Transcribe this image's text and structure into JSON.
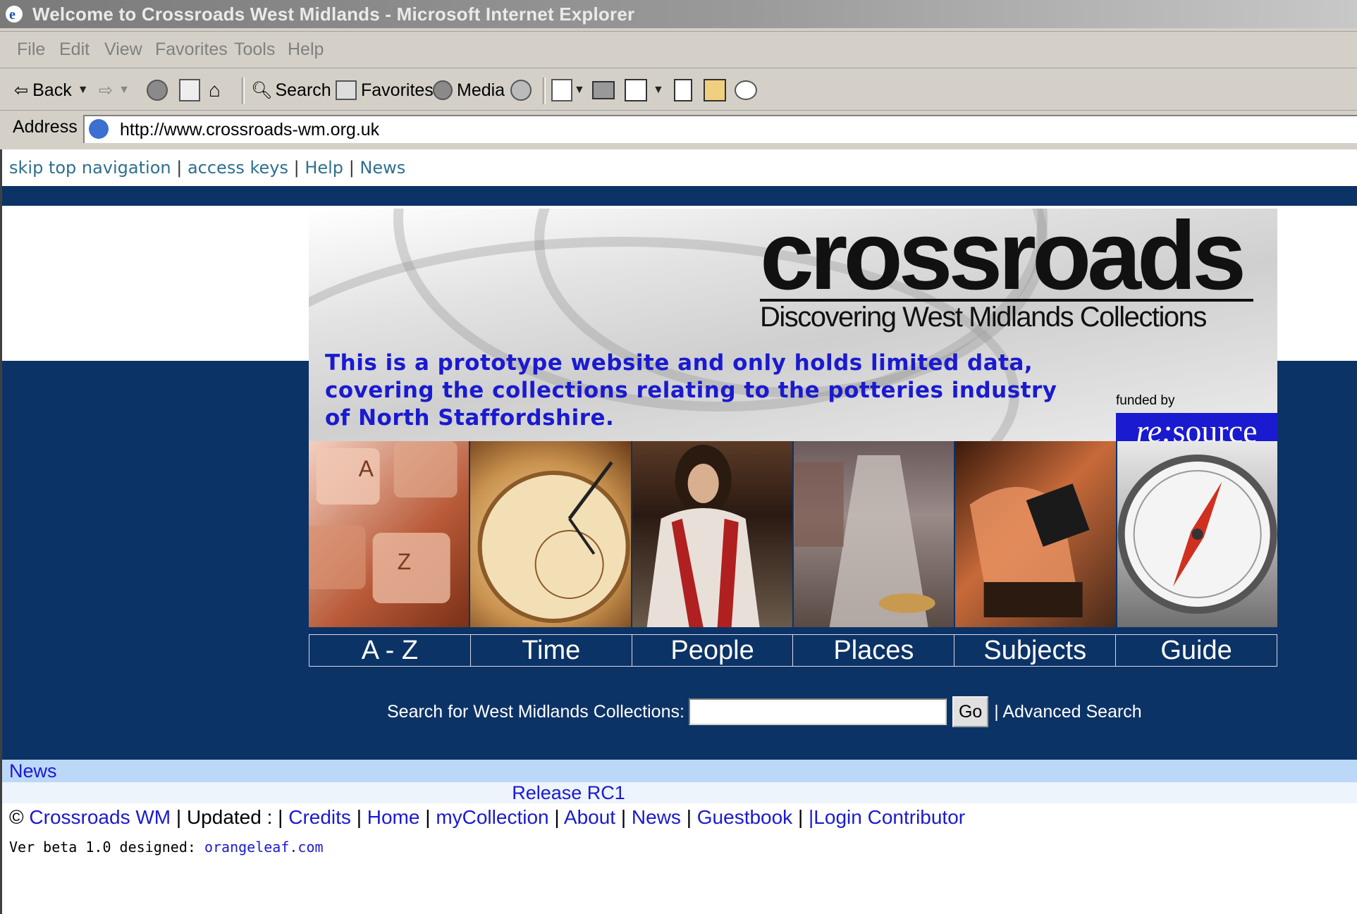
{
  "window": {
    "title": "Welcome to Crossroads West Midlands - Microsoft Internet Explorer"
  },
  "menu": [
    "File",
    "Edit",
    "View",
    "Favorites",
    "Tools",
    "Help"
  ],
  "toolbar": {
    "back": "Back",
    "search": "Search",
    "favorites": "Favorites",
    "media": "Media"
  },
  "address": {
    "label": "Address",
    "url": "http://www.crossroads-wm.org.uk"
  },
  "topnav": [
    "skip top navigation",
    "access keys",
    "Help",
    "News"
  ],
  "banner": {
    "brand": "crossroads",
    "subtitle": "Discovering West Midlands Collections",
    "notice": "This is a prototype website and only holds limited data, covering the collections relating to the potteries industry of North Staffordshire.",
    "funded_by": "funded by",
    "funder_prefix": "re:",
    "funder_name": "source"
  },
  "sections": [
    "A - Z",
    "Time",
    "People",
    "Places",
    "Subjects",
    "Guide"
  ],
  "search": {
    "label": "Search for West Midlands Collections:",
    "value": "",
    "go": "Go",
    "advanced": "| Advanced Search"
  },
  "news": {
    "heading": "News",
    "item": "Release RC1"
  },
  "footer": {
    "copyright": "©",
    "org": "Crossroads WM",
    "updated": "| Updated : |",
    "links": [
      "Credits",
      "Home",
      "myCollection",
      "About",
      "News",
      "Guestbook"
    ],
    "login": "|Login Contributor",
    "ver_prefix": "Ver beta 1.0 designed:",
    "designer": "orangeleaf.com"
  },
  "colors": {
    "navy": "#0c3366",
    "link_blue": "#1a1ad0",
    "news_bar": "#bcd8f8"
  }
}
